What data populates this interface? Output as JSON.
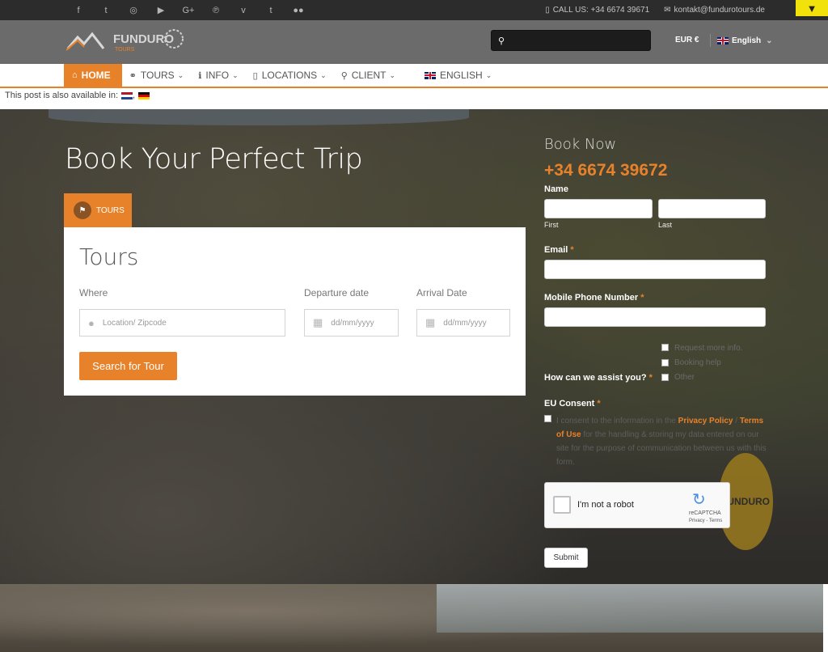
{
  "topbar": {
    "social_icons": [
      "facebook-icon",
      "twitter-icon",
      "instagram-icon",
      "youtube-icon",
      "google-plus-icon",
      "pinterest-icon",
      "vimeo-icon",
      "tumblr-icon",
      "flickr-icon"
    ],
    "social_glyphs": [
      "f",
      "t",
      "◎",
      "▶",
      "G+",
      "℗",
      "v",
      "t",
      "●●"
    ],
    "call_text": "CALL US: +34 6674 39671",
    "email_text": "kontakt@fundurotours.de",
    "toggle_glyph": "▼"
  },
  "header": {
    "logo_text": "FUNDURO",
    "logo_sub": "TOURS",
    "search_placeholder": "",
    "currency": "EUR €",
    "language": "English",
    "language_chevron": "⌄"
  },
  "nav": {
    "items": [
      {
        "label": "HOME",
        "icon": "home-icon",
        "glyph": "⌂"
      },
      {
        "label": "TOURS",
        "icon": "binoculars-icon",
        "glyph": "⚭"
      },
      {
        "label": "INFO",
        "icon": "info-icon",
        "glyph": "ℹ"
      },
      {
        "label": "LOCATIONS",
        "icon": "map-icon",
        "glyph": "▯"
      },
      {
        "label": "CLIENT",
        "icon": "user-icon",
        "glyph": "⚲"
      },
      {
        "label": "ENGLISH",
        "icon": "uk-flag-icon",
        "glyph": ""
      }
    ],
    "chevron": "⌄"
  },
  "available_text": "This post is also available in:",
  "available_sep": ",",
  "hero": {
    "title": "Book Your Perfect Trip",
    "tab_label": "TOURS",
    "tab_icon_glyph": "⚑"
  },
  "search_card": {
    "title": "Tours",
    "where_label": "Where",
    "where_placeholder": "Location/ Zipcode",
    "departure_label": "Departure date",
    "departure_placeholder": "dd/mm/yyyy",
    "arrival_label": "Arrival Date",
    "arrival_placeholder": "dd/mm/yyyy",
    "button_label": "Search for Tour"
  },
  "booking": {
    "title": "Book Now",
    "phone": "+34 6674 39672",
    "name_label": "Name",
    "first_label": "First",
    "last_label": "Last",
    "email_label": "Email",
    "mobile_label": "Mobile Phone Number",
    "assist_label": "How can we assist you?",
    "assist_options": [
      "Request more info.",
      "Booking help",
      "Other"
    ],
    "consent_label": "EU Consent",
    "required_marker": "*",
    "consent_text_part1": "I consent to the information in the",
    "privacy_link": "Privacy Policy",
    "slash": "/",
    "terms_link": "Terms of Use",
    "consent_text_part2": "for the handling & storing my data entered on our site for the purpose of communication between us with this form.",
    "captcha_text": "I'm not a robot",
    "captcha_brand": "reCAPTCHA",
    "captcha_terms": "Privacy - Terms",
    "badge_text": "FUNDURO",
    "submit_label": "Submit"
  },
  "colors": {
    "accent": "#e8822a",
    "topbar": "#2c2c2c",
    "header": "#6b6b6b",
    "yellow": "#f2e20b"
  }
}
